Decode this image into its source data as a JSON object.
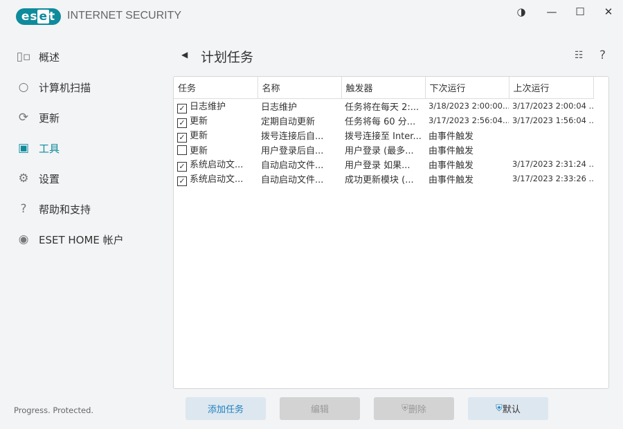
{
  "app": {
    "logo": "eset",
    "product": "INTERNET SECURITY",
    "tagline": "Progress. Protected."
  },
  "sidebar": {
    "items": [
      {
        "label": "概述",
        "icon": "dashboard-icon"
      },
      {
        "label": "计算机扫描",
        "icon": "search-icon"
      },
      {
        "label": "更新",
        "icon": "refresh-icon"
      },
      {
        "label": "工具",
        "icon": "toolbox-icon",
        "active": true
      },
      {
        "label": "设置",
        "icon": "gear-icon"
      },
      {
        "label": "帮助和支持",
        "icon": "help-icon"
      },
      {
        "label": "ESET HOME 帐户",
        "icon": "account-icon"
      }
    ]
  },
  "header": {
    "title": "计划任务",
    "help": "?"
  },
  "table": {
    "columns": [
      "任务",
      "名称",
      "触发器",
      "下次运行",
      "上次运行"
    ],
    "rows": [
      {
        "checked": true,
        "task": "日志维护",
        "name": "日志维护",
        "trigger": "任务将在每天 2:...",
        "next": "3/18/2023 2:00:00...",
        "last": "3/17/2023 2:00:04 ..."
      },
      {
        "checked": true,
        "task": "更新",
        "name": "定期自动更新",
        "trigger": "任务将每 60 分...",
        "next": "3/17/2023 2:56:04...",
        "last": "3/17/2023 1:56:04 ..."
      },
      {
        "checked": true,
        "task": "更新",
        "name": "拨号连接后自...",
        "trigger": "拨号连接至 Inter...",
        "next": "由事件触发",
        "last": ""
      },
      {
        "checked": false,
        "task": "更新",
        "name": "用户登录后自...",
        "trigger": "用户登录 (最多...",
        "next": "由事件触发",
        "last": ""
      },
      {
        "checked": true,
        "task": "系统启动文...",
        "name": "自动启动文件...",
        "trigger": "用户登录 如果...",
        "next": "由事件触发",
        "last": "3/17/2023 2:31:24 ..."
      },
      {
        "checked": true,
        "task": "系统启动文...",
        "name": "自动启动文件...",
        "trigger": "成功更新模块 (...",
        "next": "由事件触发",
        "last": "3/17/2023 2:33:26 ..."
      }
    ]
  },
  "buttons": {
    "add": "添加任务",
    "edit": "编辑",
    "delete": "删除",
    "default": "默认"
  }
}
